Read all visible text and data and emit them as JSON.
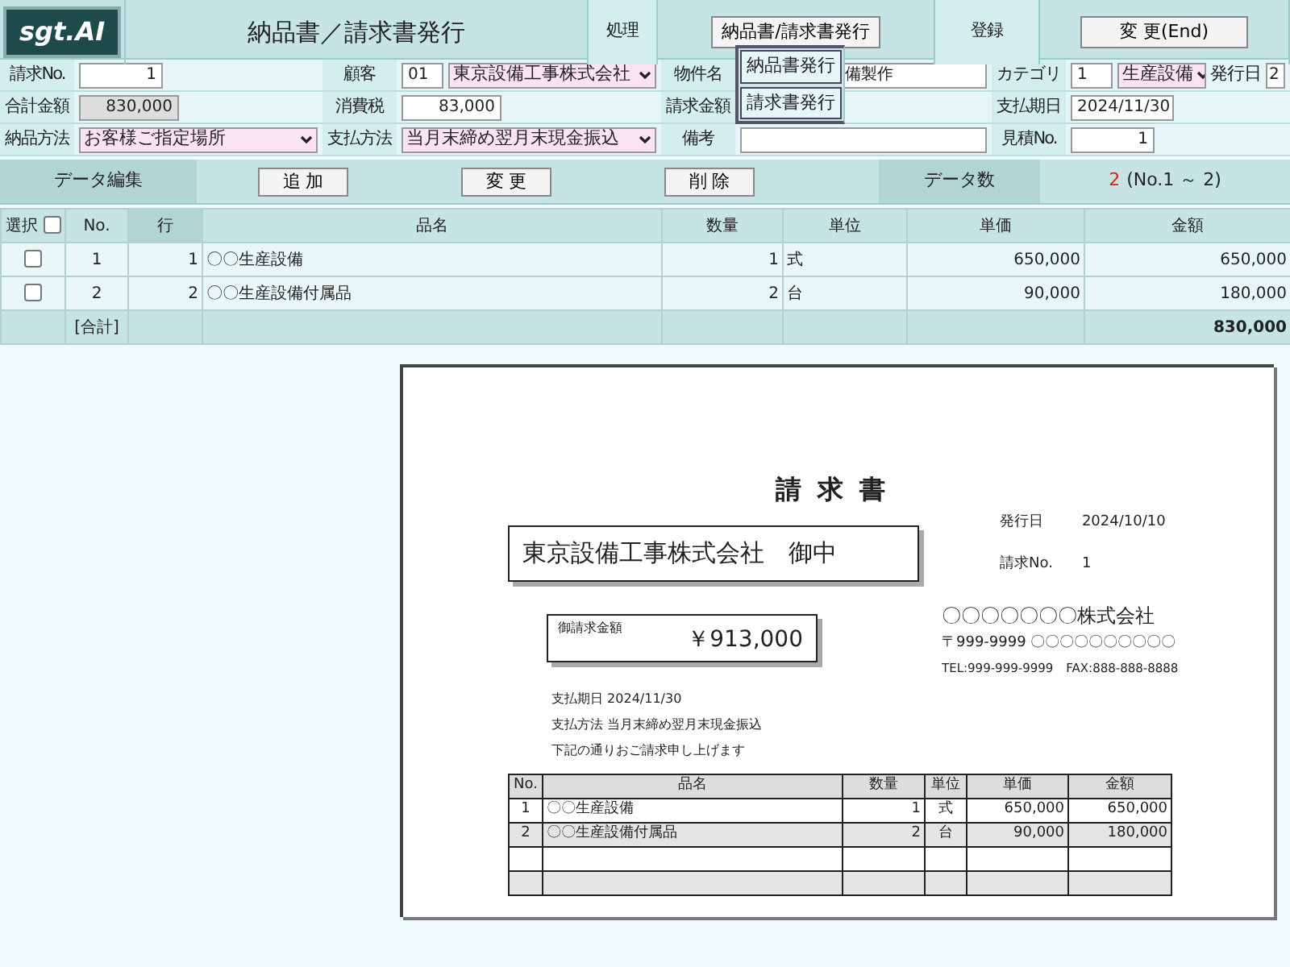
{
  "header": {
    "logo": "sgt.AI",
    "title": "納品書／請求書発行",
    "process_label": "処理",
    "process_button": "納品書/請求書発行",
    "register_label": "登録",
    "end_button": "変 更(End)"
  },
  "process_menu": [
    {
      "label": "納品書発行"
    },
    {
      "label": "請求書発行"
    }
  ],
  "form_rows": [
    [
      {
        "label": "請求No.",
        "controls": [
          {
            "kind": "short",
            "value": "1"
          }
        ]
      },
      {
        "label": "顧客",
        "controls": [
          {
            "kind": "code",
            "value": "01"
          },
          {
            "kind": "select",
            "value": "東京設備工事株式会社"
          }
        ]
      },
      {
        "label": "物件名",
        "controls": [
          {
            "kind": "covered",
            "value": "備製作"
          }
        ]
      },
      {
        "label": "カテゴリ",
        "controls": [
          {
            "kind": "code",
            "value": "1"
          },
          {
            "kind": "select",
            "value": "生産設備"
          },
          {
            "kind": "label",
            "value": "発行日"
          },
          {
            "kind": "edge",
            "value": "2"
          }
        ]
      }
    ],
    [
      {
        "label": "合計金額",
        "controls": [
          {
            "kind": "readonly",
            "value": "830,000"
          }
        ]
      },
      {
        "label": "消費税",
        "controls": [
          {
            "kind": "amount",
            "value": "83,000"
          }
        ]
      },
      {
        "label": "請求金額",
        "controls": [
          {
            "kind": "amount"
          }
        ]
      },
      {
        "label": "支払期日",
        "controls": [
          {
            "kind": "date",
            "value": "2024/11/30"
          }
        ]
      }
    ],
    [
      {
        "label": "納品方法",
        "controls": [
          {
            "kind": "select",
            "value": "お客様ご指定場所"
          }
        ]
      },
      {
        "label": "支払方法",
        "controls": [
          {
            "kind": "select",
            "value": "当月末締め翌月末現金振込"
          }
        ]
      },
      {
        "label": "備考",
        "controls": [
          {
            "kind": "text"
          }
        ]
      },
      {
        "label": "見積No.",
        "controls": [
          {
            "kind": "short",
            "value": "1"
          }
        ]
      }
    ]
  ],
  "toolbar": {
    "edit_label": "データ編集",
    "buttons": [
      "追 加",
      "変 更",
      "削 除"
    ],
    "count_label": "データ数",
    "count": "2",
    "count_range": "(No.1 ～ 2)"
  },
  "table": {
    "select_label": "選択",
    "select_all_checked": false,
    "columns": [
      "No.",
      "行",
      "品名",
      "数量",
      "単位",
      "単価",
      "金額"
    ],
    "rows": [
      {
        "checked": false,
        "cells": [
          "1",
          "1",
          "〇〇生産設備",
          "1",
          "式",
          "650,000",
          "650,000"
        ]
      },
      {
        "checked": false,
        "cells": [
          "2",
          "2",
          "〇〇生産設備付属品",
          "2",
          "台",
          "90,000",
          "180,000"
        ]
      }
    ],
    "total_label": "[合計]",
    "total": "830,000"
  },
  "invoice": {
    "title": "請求書",
    "recipient": "東京設備工事株式会社　御中",
    "issue_date_label": "発行日",
    "issue_date": "2024/10/10",
    "number_label": "請求No.",
    "number": "1",
    "amount_label": "御請求金額",
    "amount": "￥913,000",
    "company": "〇〇〇〇〇〇〇株式会社",
    "address": "〒999-9999 〇〇〇〇〇〇〇〇〇〇",
    "phone": "TEL:999-999-9999　FAX:888-888-8888",
    "lines": [
      "支払期日  2024/11/30",
      "支払方法  当月末締め翌月末現金振込",
      "下記の通りおご請求申し上げます"
    ],
    "columns": [
      "No.",
      "品名",
      "数量",
      "単位",
      "単価",
      "金額"
    ],
    "rows": [
      [
        "1",
        "〇〇生産設備",
        "1",
        "式",
        "650,000",
        "650,000"
      ],
      [
        "2",
        "〇〇生産設備付属品",
        "2",
        "台",
        "90,000",
        "180,000"
      ]
    ]
  }
}
